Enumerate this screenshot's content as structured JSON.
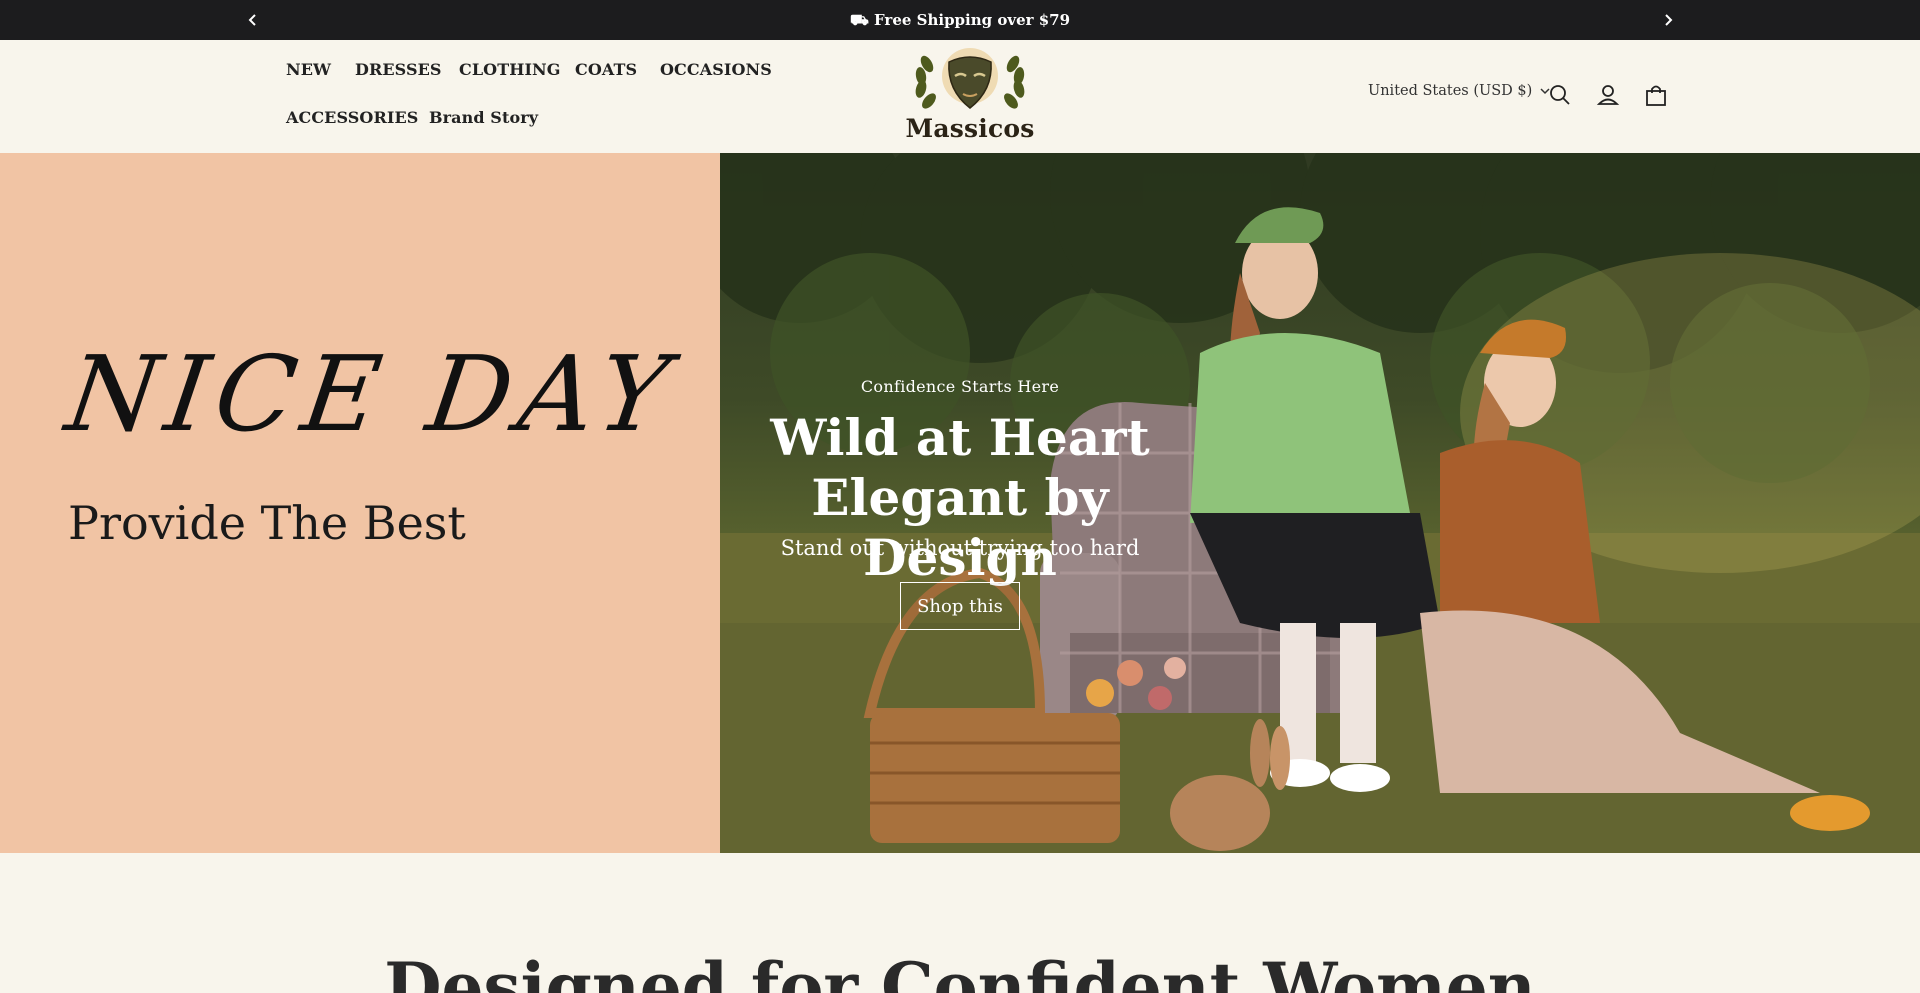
{
  "announcement": {
    "text": "⛟ Free Shipping over $79",
    "prev_label": "Previous announcement",
    "next_label": "Next announcement"
  },
  "nav": {
    "items": [
      {
        "label": "NEW"
      },
      {
        "label": "DRESSES"
      },
      {
        "label": "CLOTHING"
      },
      {
        "label": "COATS"
      },
      {
        "label": "OCCASIONS"
      },
      {
        "label": "ACCESSORIES"
      },
      {
        "label": "Brand Story"
      }
    ]
  },
  "brand": {
    "name": "Massicos"
  },
  "header": {
    "country": "United States (USD $)",
    "icons": [
      "search-icon",
      "account-icon",
      "cart-icon"
    ]
  },
  "hero_left": {
    "headline": "NICE DAY",
    "subline": "Provide The Best"
  },
  "hero_right": {
    "eyebrow": "Confidence Starts Here",
    "title_line1": "Wild at Heart",
    "title_line2": "Elegant by Design",
    "subtitle": "Stand out without trying too hard",
    "cta": "Shop this"
  },
  "section": {
    "heading": "Designed for Confident Women"
  },
  "colors": {
    "announcement_bg": "#1c1c1e",
    "page_bg": "#f8f5ec",
    "hero_left_bg": "#f1c4a4"
  }
}
